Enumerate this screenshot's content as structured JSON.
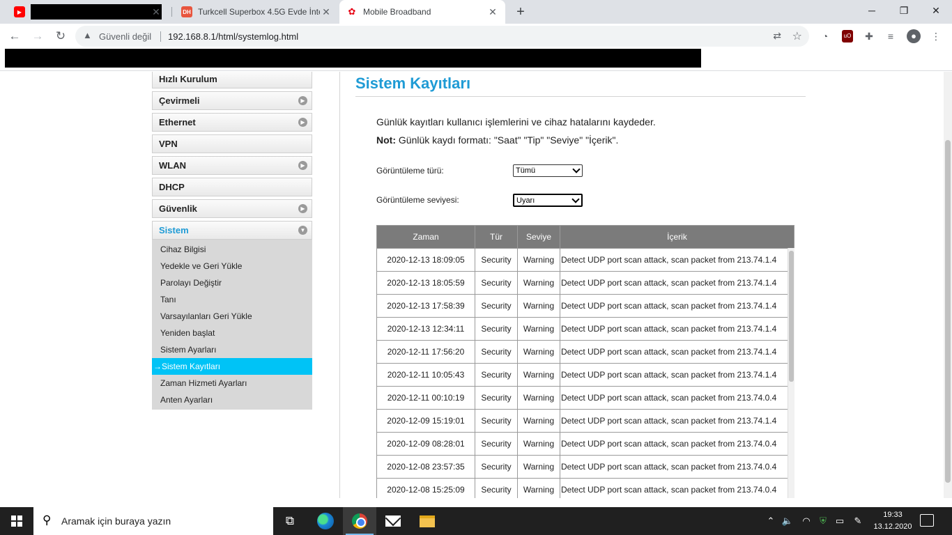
{
  "browser": {
    "tabs": [
      {
        "title": "",
        "favicon": "youtube-icon"
      },
      {
        "title": "Turkcell Superbox 4.5G Evde İnte",
        "favicon": "dh-icon"
      },
      {
        "title": "Mobile Broadband",
        "favicon": "huawei-icon"
      }
    ],
    "security_label": "Güvenli değil",
    "url": "192.168.8.1/html/systemlog.html"
  },
  "sidebar": {
    "menu": [
      {
        "label": "Hızlı Kurulum",
        "has_arrow": false
      },
      {
        "label": "Çevirmeli",
        "has_arrow": true
      },
      {
        "label": "Ethernet",
        "has_arrow": true
      },
      {
        "label": "VPN",
        "has_arrow": false
      },
      {
        "label": "WLAN",
        "has_arrow": true
      },
      {
        "label": "DHCP",
        "has_arrow": false
      },
      {
        "label": "Güvenlik",
        "has_arrow": true
      }
    ],
    "active_menu": "Sistem",
    "submenu": [
      "Cihaz Bilgisi",
      "Yedekle ve Geri Yükle",
      "Parolayı Değiştir",
      "Tanı",
      "Varsayılanları Geri Yükle",
      "Yeniden başlat",
      "Sistem Ayarları",
      "Sistem Kayıtları",
      "Zaman Hizmeti Ayarları",
      "Anten Ayarları"
    ],
    "current_prefix": "→",
    "current_index": 7
  },
  "main": {
    "title": "Sistem Kayıtları",
    "description": "Günlük kayıtları kullanıcı işlemlerini ve cihaz hatalarını kaydeder.",
    "note_label": "Not:",
    "note_text": " Günlük kaydı formatı: \"Saat\" \"Tip\" \"Seviye\" \"İçerik\".",
    "display_type_label": "Görüntüleme türü:",
    "display_type_value": "Tümü",
    "display_level_label": "Görüntüleme seviyesi:",
    "display_level_value": "Uyarı",
    "table": {
      "headers": [
        "Zaman",
        "Tür",
        "Seviye",
        "İçerik"
      ],
      "rows": [
        [
          "2020-12-13 18:09:05",
          "Security",
          "Warning",
          "Detect UDP port scan attack, scan packet from 213.74.1.4"
        ],
        [
          "2020-12-13 18:05:59",
          "Security",
          "Warning",
          "Detect UDP port scan attack, scan packet from 213.74.1.4"
        ],
        [
          "2020-12-13 17:58:39",
          "Security",
          "Warning",
          "Detect UDP port scan attack, scan packet from 213.74.1.4"
        ],
        [
          "2020-12-13 12:34:11",
          "Security",
          "Warning",
          "Detect UDP port scan attack, scan packet from 213.74.1.4"
        ],
        [
          "2020-12-11 17:56:20",
          "Security",
          "Warning",
          "Detect UDP port scan attack, scan packet from 213.74.1.4"
        ],
        [
          "2020-12-11 10:05:43",
          "Security",
          "Warning",
          "Detect UDP port scan attack, scan packet from 213.74.1.4"
        ],
        [
          "2020-12-11 00:10:19",
          "Security",
          "Warning",
          "Detect UDP port scan attack, scan packet from 213.74.0.4"
        ],
        [
          "2020-12-09 15:19:01",
          "Security",
          "Warning",
          "Detect UDP port scan attack, scan packet from 213.74.1.4"
        ],
        [
          "2020-12-09 08:28:01",
          "Security",
          "Warning",
          "Detect UDP port scan attack, scan packet from 213.74.0.4"
        ],
        [
          "2020-12-08 23:57:35",
          "Security",
          "Warning",
          "Detect UDP port scan attack, scan packet from 213.74.0.4"
        ],
        [
          "2020-12-08 15:25:09",
          "Security",
          "Warning",
          "Detect UDP port scan attack, scan packet from 213.74.0.4"
        ]
      ]
    }
  },
  "taskbar": {
    "search_placeholder": "Aramak için buraya yazın",
    "time": "19:33",
    "date": "13.12.2020"
  },
  "colors": {
    "accent": "#1f9bd5",
    "current_item": "#00c3f6",
    "table_header": "#7b7b7b"
  }
}
